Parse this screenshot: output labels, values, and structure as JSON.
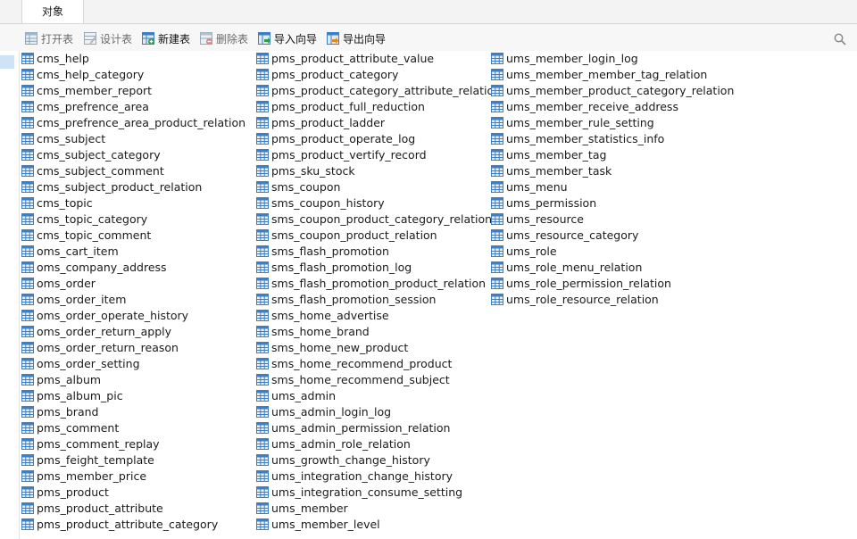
{
  "tabs": [
    {
      "label": "对象"
    }
  ],
  "toolbar": {
    "open_label": "打开表",
    "design_label": "设计表",
    "new_label": "新建表",
    "delete_label": "删除表",
    "import_label": "导入向导",
    "export_label": "导出向导"
  },
  "icons": {
    "table": "table-icon",
    "search": "search-icon"
  },
  "colors": {
    "table_icon": "#3d7fc7",
    "selection": "#cfe3f7"
  },
  "tables": {
    "column1": [
      "cms_help",
      "cms_help_category",
      "cms_member_report",
      "cms_prefrence_area",
      "cms_prefrence_area_product_relation",
      "cms_subject",
      "cms_subject_category",
      "cms_subject_comment",
      "cms_subject_product_relation",
      "cms_topic",
      "cms_topic_category",
      "cms_topic_comment",
      "oms_cart_item",
      "oms_company_address",
      "oms_order",
      "oms_order_item",
      "oms_order_operate_history",
      "oms_order_return_apply",
      "oms_order_return_reason",
      "oms_order_setting",
      "pms_album",
      "pms_album_pic",
      "pms_brand",
      "pms_comment",
      "pms_comment_replay",
      "pms_feight_template",
      "pms_member_price",
      "pms_product",
      "pms_product_attribute",
      "pms_product_attribute_category"
    ],
    "column2": [
      "pms_product_attribute_value",
      "pms_product_category",
      "pms_product_category_attribute_relation",
      "pms_product_full_reduction",
      "pms_product_ladder",
      "pms_product_operate_log",
      "pms_product_vertify_record",
      "pms_sku_stock",
      "sms_coupon",
      "sms_coupon_history",
      "sms_coupon_product_category_relation",
      "sms_coupon_product_relation",
      "sms_flash_promotion",
      "sms_flash_promotion_log",
      "sms_flash_promotion_product_relation",
      "sms_flash_promotion_session",
      "sms_home_advertise",
      "sms_home_brand",
      "sms_home_new_product",
      "sms_home_recommend_product",
      "sms_home_recommend_subject",
      "ums_admin",
      "ums_admin_login_log",
      "ums_admin_permission_relation",
      "ums_admin_role_relation",
      "ums_growth_change_history",
      "ums_integration_change_history",
      "ums_integration_consume_setting",
      "ums_member",
      "ums_member_level"
    ],
    "column3": [
      "ums_member_login_log",
      "ums_member_member_tag_relation",
      "ums_member_product_category_relation",
      "ums_member_receive_address",
      "ums_member_rule_setting",
      "ums_member_statistics_info",
      "ums_member_tag",
      "ums_member_task",
      "ums_menu",
      "ums_permission",
      "ums_resource",
      "ums_resource_category",
      "ums_role",
      "ums_role_menu_relation",
      "ums_role_permission_relation",
      "ums_role_resource_relation"
    ]
  }
}
